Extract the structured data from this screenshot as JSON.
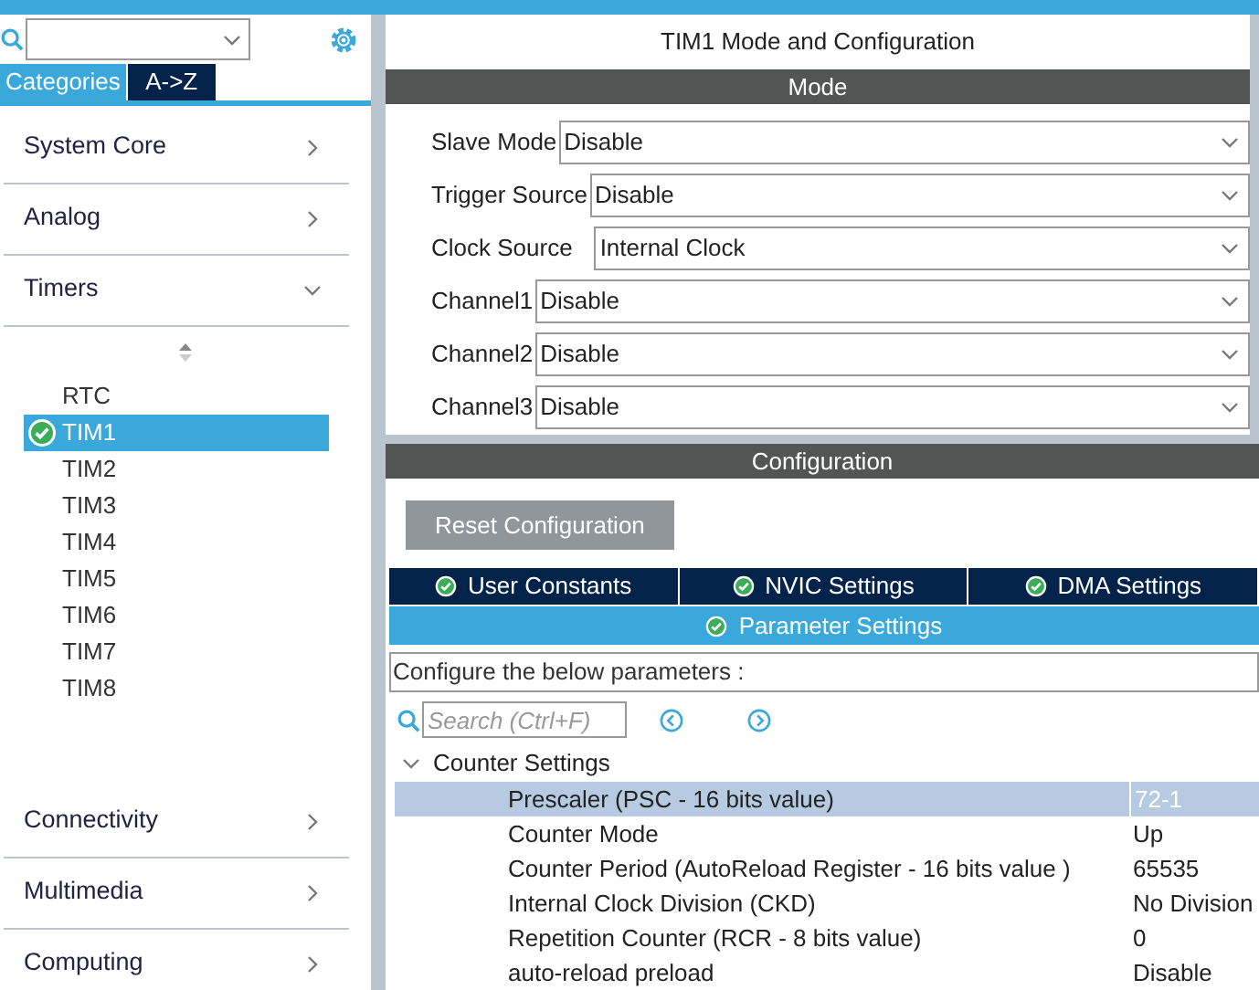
{
  "sidebar": {
    "tabs": [
      {
        "label": "Categories",
        "selected": true
      },
      {
        "label": "A->Z",
        "selected": false
      }
    ],
    "categories": [
      {
        "label": "System Core",
        "expanded": false
      },
      {
        "label": "Analog",
        "expanded": false
      },
      {
        "label": "Timers",
        "expanded": true,
        "children": [
          {
            "label": "RTC",
            "selected": false,
            "configured": false
          },
          {
            "label": "TIM1",
            "selected": true,
            "configured": true
          },
          {
            "label": "TIM2",
            "selected": false,
            "configured": false
          },
          {
            "label": "TIM3",
            "selected": false,
            "configured": false
          },
          {
            "label": "TIM4",
            "selected": false,
            "configured": false
          },
          {
            "label": "TIM5",
            "selected": false,
            "configured": false
          },
          {
            "label": "TIM6",
            "selected": false,
            "configured": false
          },
          {
            "label": "TIM7",
            "selected": false,
            "configured": false
          },
          {
            "label": "TIM8",
            "selected": false,
            "configured": false
          }
        ]
      },
      {
        "label": "Connectivity",
        "expanded": false
      },
      {
        "label": "Multimedia",
        "expanded": false
      },
      {
        "label": "Computing",
        "expanded": false
      }
    ]
  },
  "panel": {
    "title": "TIM1 Mode and Configuration",
    "mode_header": "Mode",
    "mode_fields": [
      {
        "label": "Slave Mode",
        "value": "Disable"
      },
      {
        "label": "Trigger Source",
        "value": "Disable"
      },
      {
        "label": "Clock Source",
        "value": "Internal Clock"
      },
      {
        "label": "Channel1",
        "value": "Disable"
      },
      {
        "label": "Channel2",
        "value": "Disable"
      },
      {
        "label": "Channel3",
        "value": "Disable"
      }
    ],
    "config_header": "Configuration",
    "reset_button": "Reset Configuration",
    "config_tabs": [
      {
        "label": "User Constants",
        "selected": false
      },
      {
        "label": "NVIC Settings",
        "selected": false
      },
      {
        "label": "DMA Settings",
        "selected": false
      },
      {
        "label": "Parameter Settings",
        "selected": true
      }
    ],
    "description": "Configure the below parameters :",
    "param_search": {
      "placeholder": "Search (Ctrl+F)"
    },
    "group": {
      "label": "Counter Settings",
      "expanded": true,
      "rows": [
        {
          "name": "Prescaler (PSC - 16 bits value)",
          "value": "72-1",
          "selected": true
        },
        {
          "name": "Counter Mode",
          "value": "Up",
          "selected": false
        },
        {
          "name": "Counter Period (AutoReload Register - 16 bits value )",
          "value": "65535",
          "selected": false
        },
        {
          "name": "Internal Clock Division (CKD)",
          "value": "No Division",
          "selected": false
        },
        {
          "name": "Repetition Counter (RCR - 8 bits value)",
          "value": "0",
          "selected": false
        },
        {
          "name": "auto-reload preload",
          "value": "Disable",
          "selected": false
        }
      ]
    }
  }
}
